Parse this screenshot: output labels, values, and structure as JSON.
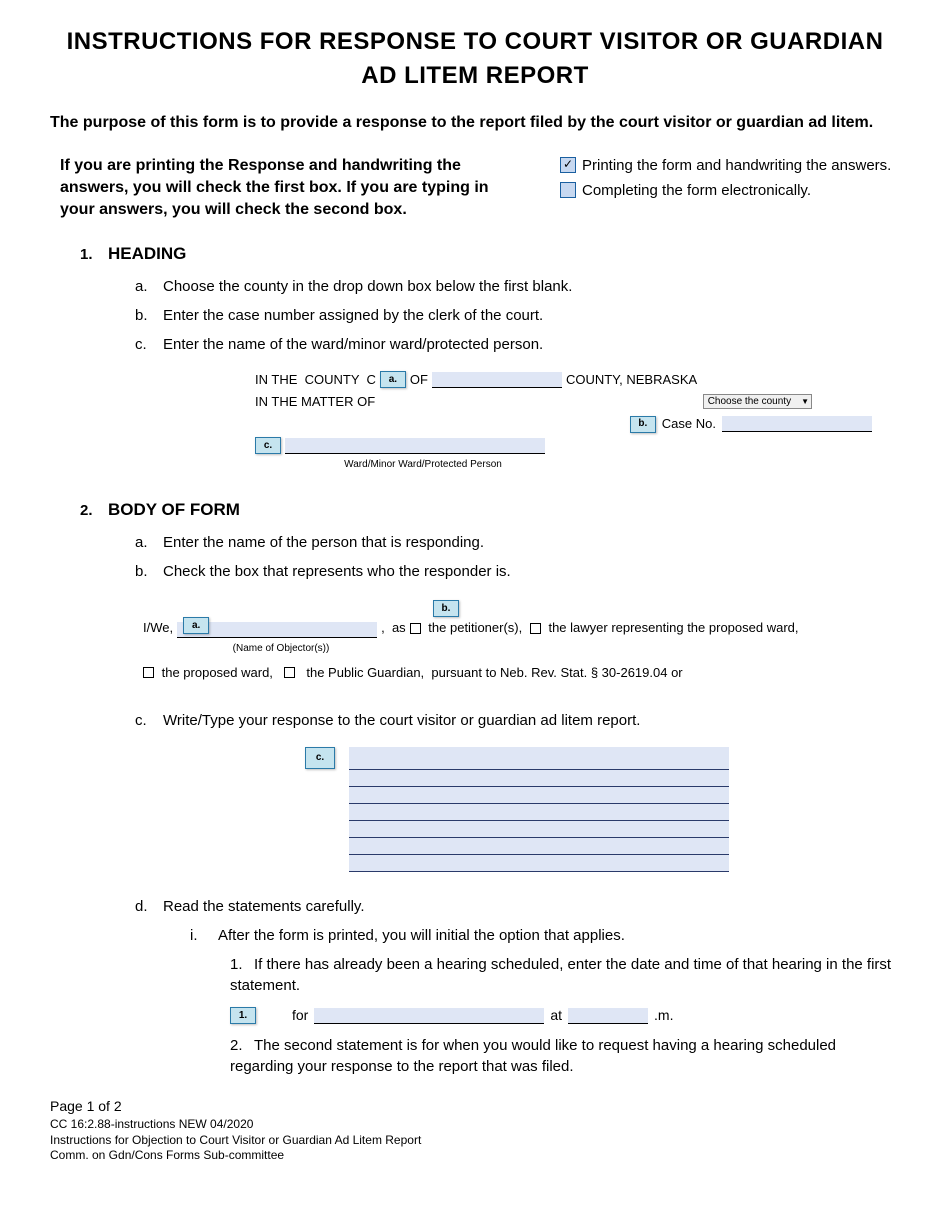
{
  "title": "INSTRUCTIONS FOR RESPONSE TO COURT VISITOR OR GUARDIAN AD LITEM REPORT",
  "purpose": "The purpose of this form is to provide a response to the report filed by the court visitor or guardian ad litem.",
  "mode": {
    "instruction": "If you are printing the Response and handwriting the answers, you will check the first box. If you are typing in your answers, you will check the second box.",
    "opt1": "Printing the form and handwriting the answers.",
    "opt2": "Completing the form electronically."
  },
  "s1": {
    "num": "1.",
    "title": "HEADING",
    "a": {
      "let": "a.",
      "text": "Choose the county in the drop down box below the first blank."
    },
    "b": {
      "let": "b.",
      "text": "Enter the case number assigned by the clerk of the court."
    },
    "c": {
      "let": "c.",
      "text": "Enter the name of the ward/minor ward/protected person."
    },
    "ex": {
      "pre1": "IN THE  COUNTY  C",
      "of": "OF",
      "county_state": "COUNTY, NEBRASKA",
      "dropdown": "Choose the county",
      "matter": "IN THE MATTER OF",
      "caseno": "Case No.",
      "ward_label": "Ward/Minor Ward/Protected Person",
      "ca": "a.",
      "cb": "b.",
      "cc": "c."
    }
  },
  "s2": {
    "num": "2.",
    "title": "BODY OF FORM",
    "a": {
      "let": "a.",
      "text": "Enter the name of the person that is responding."
    },
    "b": {
      "let": "b.",
      "text": "Check the box that represents who the responder is."
    },
    "ex": {
      "iwe": "I/We,",
      "as": ",  as",
      "pet": " the petitioner(s), ",
      "law": " the lawyer representing the proposed ward,",
      "pw": " the proposed ward,  ",
      "pg": "  the Public Guardian,  pursuant to Neb. Rev. Stat. § 30-2619.04 or",
      "name_label": "(Name of Objector(s))",
      "ca": "a.",
      "cb": "b."
    },
    "c": {
      "let": "c.",
      "text": "Write/Type your response to the court visitor or guardian ad litem report.",
      "cc": "c."
    },
    "d": {
      "let": "d.",
      "text": "Read the statements carefully.",
      "i": {
        "rom": "i.",
        "text": "After the form is printed, you will initial the option that applies."
      },
      "n1": {
        "sn": "1.",
        "text": "If there has already been a hearing scheduled, enter the date and time of that hearing in the first statement.",
        "c1": "1.",
        "for": "for",
        "at": "at",
        "m": ".m."
      },
      "n2": {
        "sn": "2.",
        "text": "The second statement is for when you would like to request having a hearing scheduled regarding your response to the report that was filed."
      }
    }
  },
  "footer": {
    "page": "Page 1 of 2",
    "l1": "CC 16:2.88-instructions NEW 04/2020",
    "l2": "Instructions for Objection to Court Visitor or Guardian Ad Litem Report",
    "l3": "Comm. on Gdn/Cons Forms Sub-committee"
  }
}
